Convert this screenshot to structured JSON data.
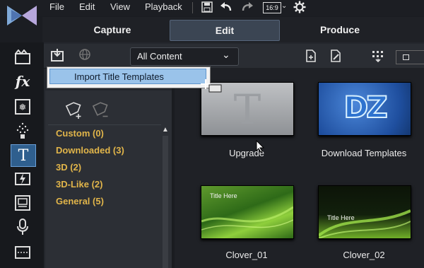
{
  "menu": {
    "file": "File",
    "edit": "Edit",
    "view": "View",
    "playback": "Playback",
    "aspect": "16:9"
  },
  "modes": {
    "capture": "Capture",
    "edit": "Edit",
    "produce": "Produce"
  },
  "library": {
    "content_select": "All Content",
    "popup_item": "Import Title Templates",
    "categories": [
      "Custom  (0)",
      "Downloaded  (3)",
      "3D  (2)",
      "3D-Like  (2)",
      "General  (5)"
    ],
    "thumbnails": [
      {
        "caption": "Upgrade",
        "letter": "T"
      },
      {
        "caption": "Download Templates",
        "letter": "DZ"
      },
      {
        "caption": "Clover_01",
        "title": "Title Here"
      },
      {
        "caption": "Clover_02",
        "title": "Title Here"
      }
    ]
  },
  "colors": {
    "accent": "#2f5f8e",
    "category_text": "#e1b54a",
    "popup_highlight": "#9ac3ea"
  }
}
